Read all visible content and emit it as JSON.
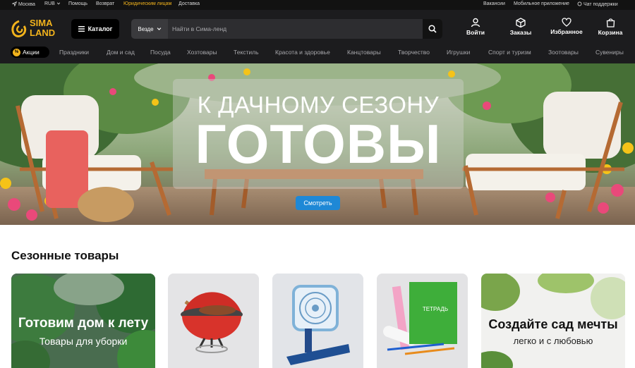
{
  "topbar": {
    "city": "Москва",
    "currency": "RUB",
    "help": "Помощь",
    "returns": "Возврат",
    "legal": "Юридическим лицам",
    "delivery": "Доставка",
    "jobs": "Вакансии",
    "mobile_app": "Мобильное приложение",
    "support_chat": "Чат поддержки",
    "accent_color": "#f2b31c"
  },
  "header": {
    "logo_line1": "SIMA",
    "logo_line2": "LAND",
    "catalog_label": "Каталог",
    "search": {
      "scope": "Везде",
      "placeholder": "Найти в Сима-ленд"
    },
    "actions": {
      "login": "Войти",
      "orders": "Заказы",
      "favorites": "Избранное",
      "cart": "Корзина"
    }
  },
  "nav": {
    "promo": "Акции",
    "promo_badge": "%",
    "items": [
      "Праздники",
      "Дом и сад",
      "Посуда",
      "Хозтовары",
      "Текстиль",
      "Красота и здоровье",
      "Канцтовары",
      "Творчество",
      "Игрушки",
      "Спорт и туризм",
      "Зоотовары",
      "Сувениры"
    ]
  },
  "hero": {
    "line1": "К ДАЧНОМУ СЕЗОНУ",
    "line2": "ГОТОВЫ",
    "cta": "Смотреть",
    "cta_color": "#1e88d6"
  },
  "seasonal": {
    "title": "Сезонные товары",
    "cards": [
      {
        "title": "Готовим дом к лету",
        "subtitle": "Товары для уборки"
      },
      {
        "title": "",
        "subtitle": ""
      },
      {
        "title": "",
        "subtitle": ""
      },
      {
        "title": "",
        "subtitle": "",
        "notebook_label": "ТЕТРАДЬ"
      },
      {
        "title": "Создайте сад мечты",
        "subtitle": "легко и с любовью"
      }
    ]
  }
}
